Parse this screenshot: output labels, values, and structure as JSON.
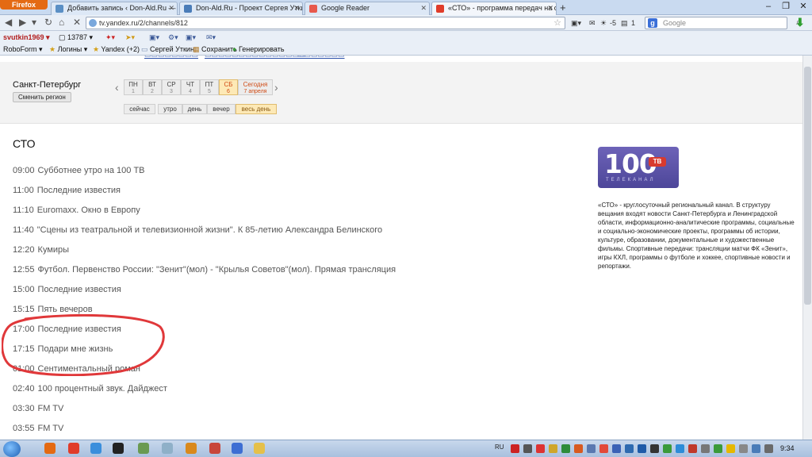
{
  "browser": {
    "menu_label": "Firefox",
    "tabs": [
      {
        "title": "Добавить запись ‹ Don-Ald.Ru — W..."
      },
      {
        "title": "Don-Ald.Ru - Проект Сергея Уткина"
      },
      {
        "title": "Google Reader"
      },
      {
        "title": "«СТО» - программа передач на сег...",
        "active": true
      }
    ],
    "new_tab": "+",
    "url": "tv.yandex.ru/2/channels/812",
    "nav_extras": {
      "count_a": "-5",
      "count_b": "1"
    },
    "search_placeholder": "Google",
    "search_engine_letter": "g"
  },
  "toolbar1": {
    "user": "svutkin1969",
    "counter": "13787"
  },
  "toolbar2": {
    "roboform": "RoboForm",
    "logins": "Логины",
    "yandex": "Yandex",
    "yandex_count": "(+2)",
    "bookmark_1": "Сергей Уткин",
    "bookmark_2": "Сохранить",
    "bookmark_3": "Генерировать"
  },
  "region": {
    "city": "Санкт-Петербург",
    "change_button": "Сменить регион",
    "days": [
      {
        "label": "ПН",
        "num": "1"
      },
      {
        "label": "ВТ",
        "num": "2"
      },
      {
        "label": "СР",
        "num": "3"
      },
      {
        "label": "ЧТ",
        "num": "4"
      },
      {
        "label": "ПТ",
        "num": "5"
      },
      {
        "label": "СБ",
        "num": "6",
        "selected": true
      },
      {
        "label": "Сегодня",
        "num": "7 апреля"
      }
    ],
    "periods": [
      "сейчас",
      "утро",
      "день",
      "вечер",
      "весь день"
    ],
    "selected_period": "весь день"
  },
  "channel": {
    "title": "СТО",
    "logo_text": "100",
    "logo_badge": "ТВ",
    "logo_sub": "ТЕЛЕКАНАЛ",
    "description": "«СТО» - круглосуточный региональный канал. В структуру вещания входят новости Санкт-Петербурга и Ленинградской области, информационно-аналитические программы, социальные и социально-экономические проекты, программы об истории, культуре, образовании, документальные и художественные фильмы. Спортивные передачи: трансляции матчи ФК «Зенит», игры КХЛ, программы о футболе и хоккее, спортивные новости и репортажи."
  },
  "schedule": [
    {
      "time": "09:00",
      "title": "Субботнее утро на 100 ТВ"
    },
    {
      "time": "11:00",
      "title": "Последние известия"
    },
    {
      "time": "11:10",
      "title": "Euromaxx. Окно в Европу"
    },
    {
      "time": "11:40",
      "title": "\"Сцены из театральной и телевизионной жизни\". К 85-летию Александра Белинского"
    },
    {
      "time": "12:20",
      "title": "Кумиры"
    },
    {
      "time": "12:55",
      "title": "Футбол. Первенство России: \"Зенит\"(мол) - \"Крылья Советов\"(мол). Прямая трансляция"
    },
    {
      "time": "15:00",
      "title": "Последние известия"
    },
    {
      "time": "15:15",
      "title": "Пять вечеров"
    },
    {
      "time": "17:00",
      "title": "Последние известия"
    },
    {
      "time": "17:15",
      "title": "Подари мне жизнь"
    },
    {
      "time": "01:00",
      "title": "Сентиментальный роман"
    },
    {
      "time": "02:40",
      "title": "100 процентный звук. Дайджест"
    },
    {
      "time": "03:30",
      "title": "FM TV"
    },
    {
      "time": "03:55",
      "title": "FM TV"
    }
  ],
  "taskbar": {
    "lang": "RU",
    "clock": "9:34"
  },
  "colors": {
    "annotation": "#e0383a",
    "accent_orange": "#d04b15",
    "logo_purple": "#5a52a8"
  }
}
